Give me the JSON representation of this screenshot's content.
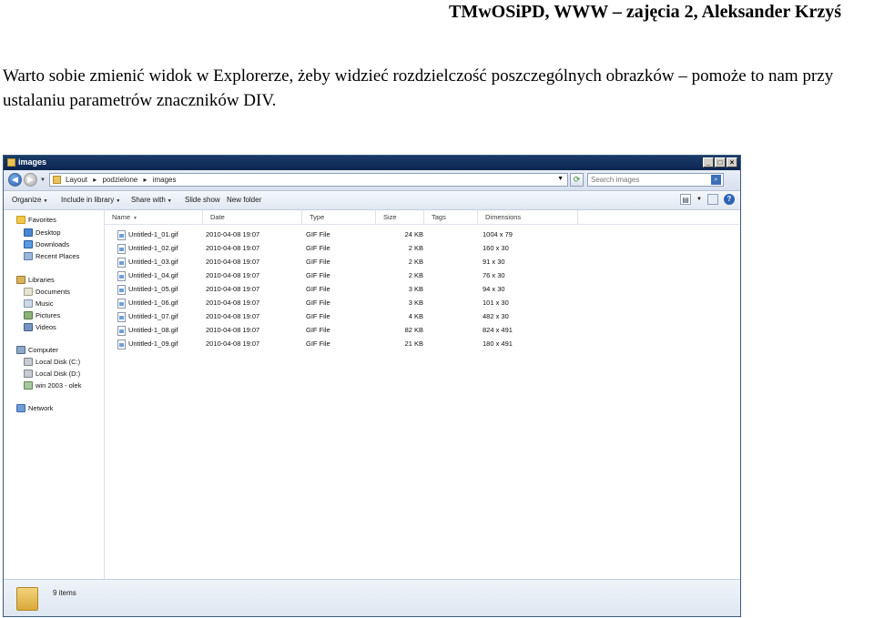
{
  "document": {
    "header": "TMwOSiPD, WWW – zajęcia 2, Aleksander Krzyś",
    "paragraph": "Warto sobie zmienić widok w Explorerze, żeby widzieć rozdzielczość poszczególnych obrazków – pomoże to nam przy ustalaniu parametrów znaczników DIV."
  },
  "window": {
    "title": "images",
    "address": {
      "crumbs": [
        "Layout",
        "▸",
        "podzielone",
        "▸",
        "images"
      ]
    },
    "search": {
      "placeholder": "Search images"
    },
    "toolbar": {
      "organize": "Organize",
      "include_in_library": "Include in library",
      "share_with": "Share with",
      "slide_show": "Slide show",
      "new_folder": "New folder"
    },
    "nav": {
      "favorites": "Favorites",
      "desktop": "Desktop",
      "downloads": "Downloads",
      "recent_places": "Recent Places",
      "libraries": "Libraries",
      "documents": "Documents",
      "music": "Music",
      "pictures": "Pictures",
      "videos": "Videos",
      "computer": "Computer",
      "disk_c": "Local Disk (C:)",
      "disk_d": "Local Disk (D:)",
      "net_drive": "win 2003 - olek",
      "network": "Network"
    },
    "columns": {
      "name": "Name",
      "date": "Date",
      "type": "Type",
      "size": "Size",
      "tags": "Tags",
      "dimensions": "Dimensions"
    },
    "files": [
      {
        "name": "Untitled-1_01.gif",
        "date": "2010-04-08 19:07",
        "type": "GIF File",
        "size": "24 KB",
        "dimensions": "1004 x 79"
      },
      {
        "name": "Untitled-1_02.gif",
        "date": "2010-04-08 19:07",
        "type": "GIF File",
        "size": "2 KB",
        "dimensions": "160 x 30"
      },
      {
        "name": "Untitled-1_03.gif",
        "date": "2010-04-08 19:07",
        "type": "GIF File",
        "size": "2 KB",
        "dimensions": "91 x 30"
      },
      {
        "name": "Untitled-1_04.gif",
        "date": "2010-04-08 19:07",
        "type": "GIF File",
        "size": "2 KB",
        "dimensions": "76 x 30"
      },
      {
        "name": "Untitled-1_05.gif",
        "date": "2010-04-08 19:07",
        "type": "GIF File",
        "size": "3 KB",
        "dimensions": "94 x 30"
      },
      {
        "name": "Untitled-1_06.gif",
        "date": "2010-04-08 19:07",
        "type": "GIF File",
        "size": "3 KB",
        "dimensions": "101 x 30"
      },
      {
        "name": "Untitled-1_07.gif",
        "date": "2010-04-08 19:07",
        "type": "GIF File",
        "size": "4 KB",
        "dimensions": "482 x 30"
      },
      {
        "name": "Untitled-1_08.gif",
        "date": "2010-04-08 19:07",
        "type": "GIF File",
        "size": "82 KB",
        "dimensions": "824 x 491"
      },
      {
        "name": "Untitled-1_09.gif",
        "date": "2010-04-08 19:07",
        "type": "GIF File",
        "size": "21 KB",
        "dimensions": "180 x 491"
      }
    ],
    "status": {
      "item_count": "9 items"
    }
  }
}
